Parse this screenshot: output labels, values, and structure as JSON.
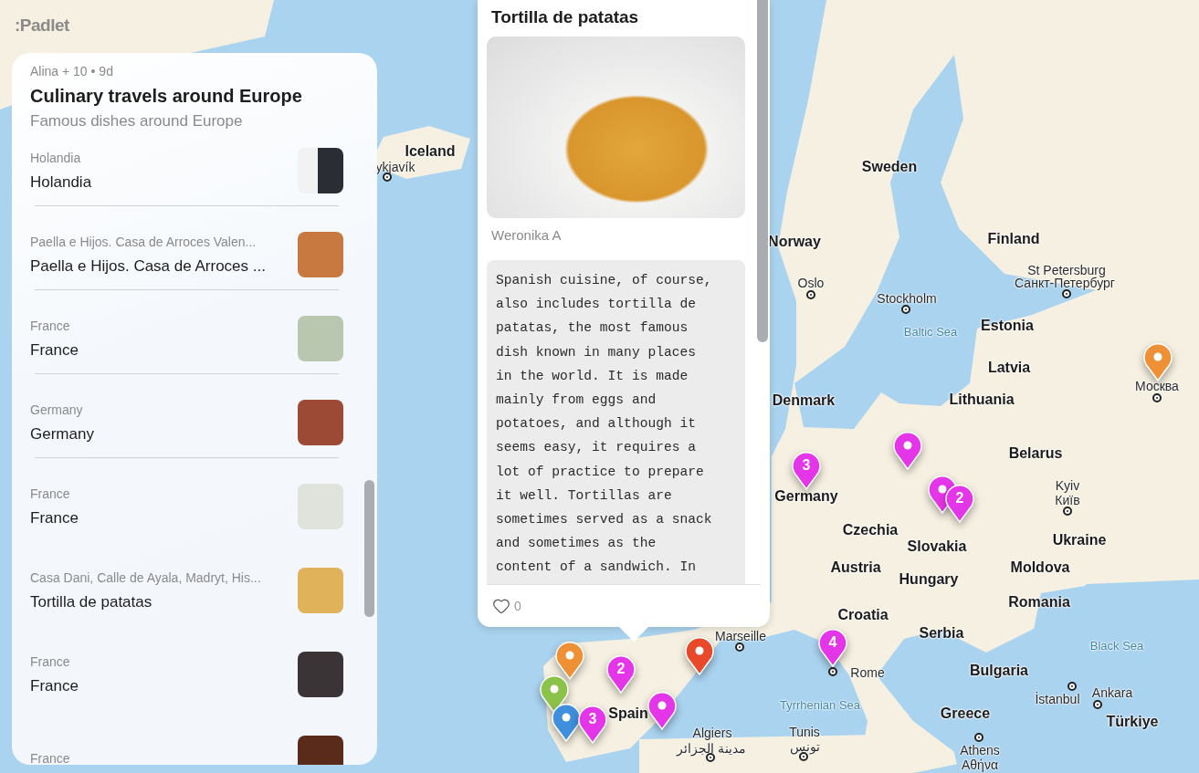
{
  "app": {
    "logo": ":Padlet"
  },
  "board": {
    "meta": "Alina + 10 •  9d",
    "title": "Culinary travels around Europe",
    "description": "Famous dishes around Europe",
    "posts": [
      {
        "subtitle": "Holandia",
        "title": "Holandia",
        "divider": true
      },
      {
        "subtitle": "Paella e Hijos. Casa de Arroces Valen...",
        "title": "Paella e Hijos. Casa de Arroces ...",
        "divider": true
      },
      {
        "subtitle": "France",
        "title": "France",
        "divider": true
      },
      {
        "subtitle": "Germany",
        "title": "Germany",
        "divider": true
      },
      {
        "subtitle": "France",
        "title": "France",
        "divider": false
      },
      {
        "subtitle": "Casa Dani, Calle de Ayala, Madryt, His...",
        "title": "Tortilla de patatas",
        "divider": false
      },
      {
        "subtitle": "France",
        "title": "France",
        "divider": false
      },
      {
        "subtitle": "France"
      }
    ]
  },
  "post_popup": {
    "title": "Tortilla de patatas",
    "author": "Weronika A",
    "body": "Spanish cuisine, of course, also includes tortilla de patatas, the most famous dish known in many places in the world. It is made mainly from eggs and potatoes, and although it seems easy, it requires a lot of practice to prepare it well. Tortillas are sometimes served as a snack and sometimes as the content of a sandwich. In",
    "likes": "0"
  },
  "map": {
    "labels": [
      {
        "text": "Iceland",
        "kind": "country"
      },
      {
        "text": "ykjavík",
        "kind": "city"
      },
      {
        "text": "Sweden",
        "kind": "country"
      },
      {
        "text": "Norway",
        "kind": "country"
      },
      {
        "text": "Finland",
        "kind": "country"
      },
      {
        "text": "Oslo",
        "kind": "city"
      },
      {
        "text": "Stockholm",
        "kind": "city"
      },
      {
        "text": "St Petersburg",
        "kind": "city"
      },
      {
        "text": "Санкт-Петербург",
        "kind": "city"
      },
      {
        "text": "Baltic Sea",
        "kind": "sea"
      },
      {
        "text": "Estonia",
        "kind": "country"
      },
      {
        "text": "Latvia",
        "kind": "country"
      },
      {
        "text": "Lithuania",
        "kind": "country"
      },
      {
        "text": "Denmark",
        "kind": "country"
      },
      {
        "text": "Belarus",
        "kind": "country"
      },
      {
        "text": "Москва",
        "kind": "city"
      },
      {
        "text": "Germany",
        "kind": "country"
      },
      {
        "text": "Kyiv",
        "kind": "city"
      },
      {
        "text": "Київ",
        "kind": "city"
      },
      {
        "text": "Czechia",
        "kind": "country"
      },
      {
        "text": "Slovakia",
        "kind": "country"
      },
      {
        "text": "Ukraine",
        "kind": "country"
      },
      {
        "text": "Austria",
        "kind": "country"
      },
      {
        "text": "Hungary",
        "kind": "country"
      },
      {
        "text": "Moldova",
        "kind": "country"
      },
      {
        "text": "Romania",
        "kind": "country"
      },
      {
        "text": "Croatia",
        "kind": "country"
      },
      {
        "text": "Serbia",
        "kind": "country"
      },
      {
        "text": "Marseille",
        "kind": "city"
      },
      {
        "text": "Black Sea",
        "kind": "sea"
      },
      {
        "text": "Rome",
        "kind": "city"
      },
      {
        "text": "Bulgaria",
        "kind": "country"
      },
      {
        "text": "Tyrrhenian Sea",
        "kind": "sea"
      },
      {
        "text": "Spain",
        "kind": "country"
      },
      {
        "text": "İstanbul",
        "kind": "city"
      },
      {
        "text": "Ankara",
        "kind": "city"
      },
      {
        "text": "Greece",
        "kind": "country"
      },
      {
        "text": "Türkiye",
        "kind": "country"
      },
      {
        "text": "Algiers",
        "kind": "city"
      },
      {
        "text": "مدينة الجزائر",
        "kind": "city"
      },
      {
        "text": "Tunis",
        "kind": "city"
      },
      {
        "text": "تونس",
        "kind": "city"
      },
      {
        "text": "Athens",
        "kind": "city"
      },
      {
        "text": "Αθήνα",
        "kind": "city"
      }
    ],
    "pins": [
      {
        "color": "#ee9035"
      },
      {
        "color": "#e535e8"
      },
      {
        "color": "#e535e8"
      },
      {
        "color": "#e535e8",
        "count": "2"
      },
      {
        "color": "#e535e8",
        "count": "3"
      },
      {
        "color": "#e535e8",
        "count": "4"
      },
      {
        "color": "#e8492a"
      },
      {
        "color": "#e535e8",
        "count": "2"
      },
      {
        "color": "#e535e8"
      },
      {
        "color": "#ee9035"
      },
      {
        "color": "#8bc34a"
      },
      {
        "color": "#3f8fdc"
      },
      {
        "color": "#e535e8",
        "count": "3"
      }
    ]
  }
}
